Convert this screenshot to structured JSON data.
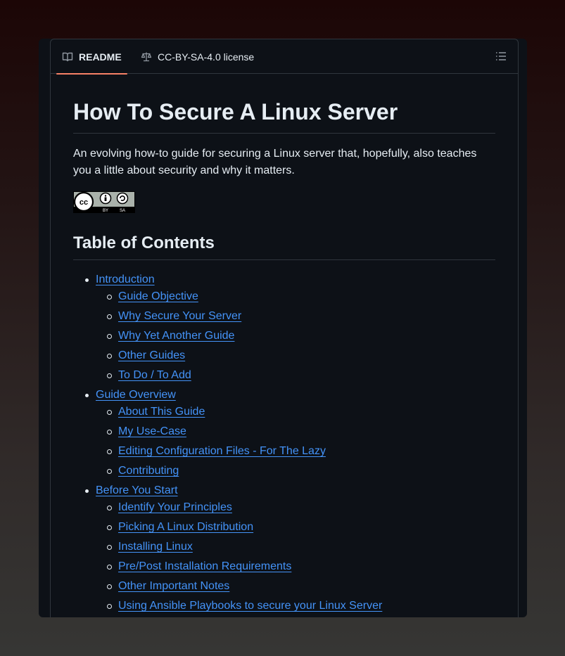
{
  "tabs": {
    "readme": "README",
    "license": "CC-BY-SA-4.0 license"
  },
  "readme": {
    "title": "How To Secure A Linux Server",
    "intro": "An evolving how-to guide for securing a Linux server that, hopefully, also teaches you a little about security and why it matters.",
    "badge": {
      "cc": "cc",
      "by": "BY",
      "sa": "SA"
    },
    "toc_heading": "Table of Contents",
    "toc": [
      {
        "label": "Introduction",
        "children": [
          "Guide Objective",
          "Why Secure Your Server",
          "Why Yet Another Guide",
          "Other Guides",
          "To Do / To Add"
        ]
      },
      {
        "label": "Guide Overview",
        "children": [
          "About This Guide",
          "My Use-Case",
          "Editing Configuration Files - For The Lazy",
          "Contributing"
        ]
      },
      {
        "label": "Before You Start",
        "children": [
          "Identify Your Principles",
          "Picking A Linux Distribution",
          "Installing Linux",
          "Pre/Post Installation Requirements",
          "Other Important Notes",
          "Using Ansible Playbooks to secure your Linux Server"
        ]
      }
    ]
  },
  "colors": {
    "background": "#0d1117",
    "border": "#30363d",
    "text": "#e6edf3",
    "link": "#4493f8",
    "tab_accent": "#f78166"
  }
}
